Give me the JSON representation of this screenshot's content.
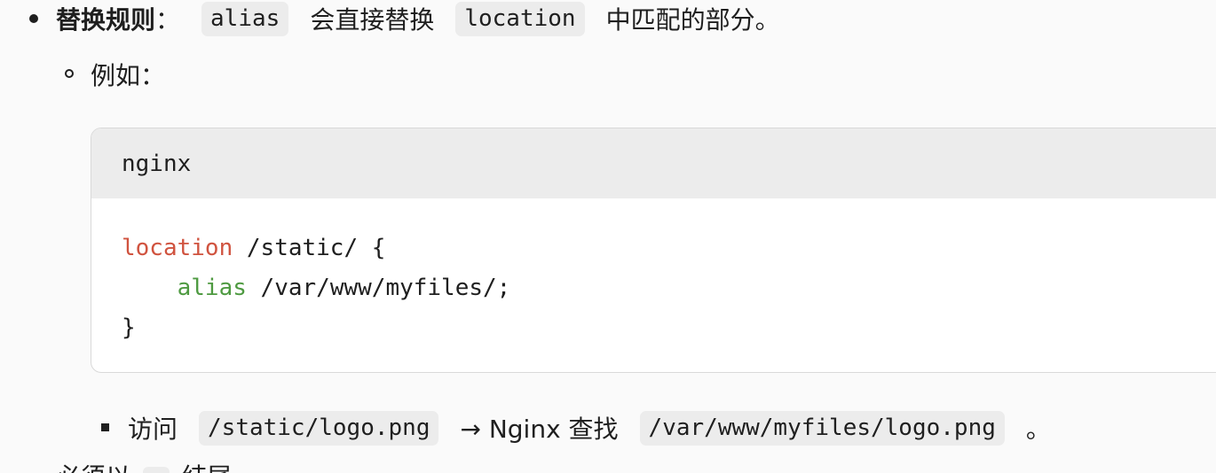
{
  "list": {
    "item1": {
      "label_bold": "替换规则",
      "colon": "：",
      "code1": "alias",
      "text1": "会直接替换",
      "code2": "location",
      "text2": "中匹配的部分。"
    },
    "sub_item": {
      "text": "例如："
    },
    "code_block": {
      "language": "nginx",
      "line1_kw": "location",
      "line1_rest": " /static/ {",
      "line2_indent": "    ",
      "line2_kw": "alias",
      "line2_rest": " /var/www/myfiles/;",
      "line3": "}",
      "keyword_colors": {
        "location": "#d0533f",
        "alias": "#4e9a41"
      }
    },
    "sub_sub_item": {
      "text1": "访问",
      "code1": "/static/logo.png",
      "arrow_text": "→ Nginx 查找",
      "code2": "/var/www/myfiles/logo.png",
      "end": "。"
    },
    "next_item_partial": {
      "text1": "必须以",
      "text2": "结尾"
    }
  }
}
